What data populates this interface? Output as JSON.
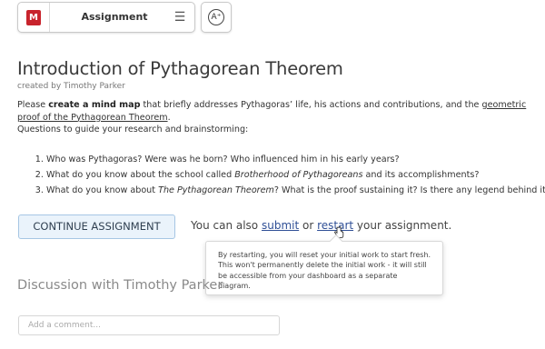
{
  "header": {
    "logo_text": "M",
    "title": "Assignment",
    "menu_icon": "hamburger-icon",
    "font_size_icon": "A⁺",
    "brand_color": "#c8232c"
  },
  "assignment": {
    "title": "Introduction of Pythagorean Theorem",
    "byline": "created by Timothy Parker",
    "intro": {
      "p1": "Please ",
      "b1": "create a mind map",
      "p2": " that briefly addresses Pythagoras’ life, his actions and contributions, and the ",
      "u1": "geometric proof of the Pythagorean Theorem",
      "p3": "."
    },
    "guide": "Questions to guide your research and brainstorming:",
    "questions": {
      "q1": "Who was Pythagoras? Were was he born? Who influenced him in his early years?",
      "q2a": "What do you know about the school called ",
      "q2i": "Brotherhood of Pythagoreans",
      "q2b": " and its accomplishments?",
      "q3a": "What do you know about ",
      "q3i": "The Pythagorean Theorem",
      "q3b": "? What is the proof sustaining it? Is there any legend behind it?"
    }
  },
  "actions": {
    "continue_label": "CONTINUE ASSIGNMENT",
    "alt_prefix": "You can also ",
    "submit_label": "submit",
    "alt_or": " or ",
    "restart_label": "restart",
    "alt_suffix": " your assignment.",
    "link_color": "#2f4f96",
    "tooltip": "By restarting, you will reset your initial work to start fresh. This won't permanently delete the initial work - it will still be accessible from your dashboard as a separate diagram."
  },
  "discussion": {
    "title": "Discussion with Timothy Parker",
    "comment_placeholder": "Add a comment..."
  }
}
